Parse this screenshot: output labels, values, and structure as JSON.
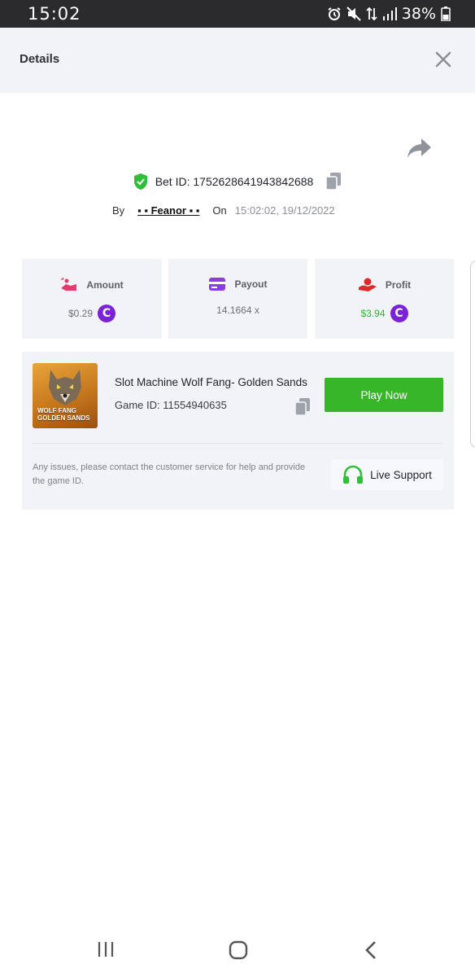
{
  "status_bar": {
    "time": "15:02",
    "battery": "38%"
  },
  "header": {
    "title": "Details"
  },
  "bet": {
    "id_label": "Bet ID: 1752628641943842688",
    "by_label": "By",
    "user": "▪ ▪ Feanor ▪ ▪",
    "on_label": "On",
    "datetime": "15:02:02, 19/12/2022"
  },
  "stats": {
    "amount": {
      "label": "Amount",
      "value": "$0.29"
    },
    "payout": {
      "label": "Payout",
      "value": "14.1664 x"
    },
    "profit": {
      "label": "Profit",
      "value": "$3.94"
    }
  },
  "game": {
    "thumbnail_text_line1": "WOLF FANG",
    "thumbnail_text_line2": "GOLDEN SANDS",
    "name": "Slot Machine Wolf Fang- Golden Sands",
    "id_label": "Game ID: 11554940635",
    "play_button": "Play Now",
    "support_note": "Any issues, please contact the customer service for help and provide the game ID.",
    "support_button": "Live Support"
  },
  "colors": {
    "accent_green": "#38b62a",
    "profit_green": "#2db82d",
    "coin_purple": "#7a23d6",
    "panel_bg": "#f2f3f7"
  },
  "icons": {
    "close": "close-icon",
    "share": "share-icon",
    "verified": "shield-check-icon",
    "copy": "copy-icon",
    "amount": "hand-coin-icon",
    "payout": "card-icon",
    "profit": "profit-hand-icon",
    "coin": "coin-icon",
    "support": "headphones-icon"
  }
}
